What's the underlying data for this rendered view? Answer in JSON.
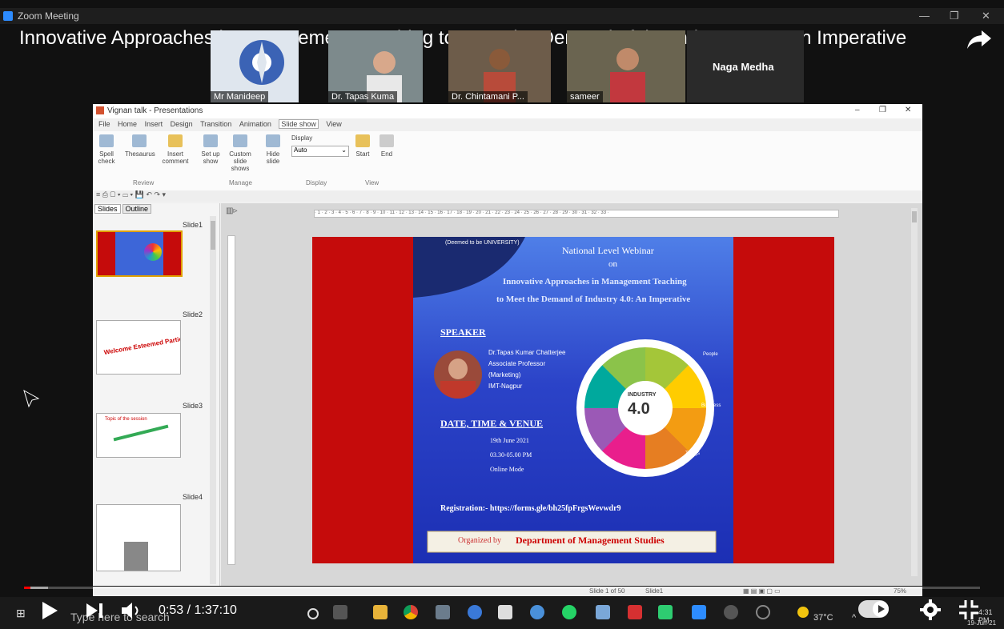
{
  "zoom": {
    "window_title": "Zoom Meeting"
  },
  "video": {
    "title": "Innovative Approaches in Management Teaching to Meet the Demand of the Industry 4.0 - An Imperative"
  },
  "participants": [
    {
      "name": "Mr Manideep"
    },
    {
      "name": "Dr. Tapas Kuma"
    },
    {
      "name": "Dr. Chintamani P..."
    },
    {
      "name": "sameer"
    },
    {
      "name": "Naga Medha"
    }
  ],
  "ppt": {
    "window_title": "Vignan talk - Presentations",
    "menu": [
      "File",
      "Home",
      "Insert",
      "Design",
      "Transition",
      "Animation",
      "Slide show",
      "View"
    ],
    "ribbon": {
      "spell_check": "Spell check",
      "thesaurus": "Thesaurus",
      "insert_comment": "Insert comment",
      "set_up_show": "Set up show",
      "custom_slide_shows": "Custom slide shows",
      "hide_slide": "Hide slide",
      "display_label": "Display",
      "display_value": "Auto",
      "start": "Start",
      "end": "End",
      "groups": [
        "Review",
        "Manage",
        "Display",
        "View"
      ]
    },
    "tabs": [
      "Slides",
      "Outline"
    ],
    "slide_labels": [
      "Slide1",
      "Slide2",
      "Slide3",
      "Slide4"
    ],
    "slide2_text": "Welcome Esteemed Participants !",
    "slide3_text": "Topic of the session",
    "status": {
      "slide_count": "Slide 1 of 50",
      "slide_name": "Slide1",
      "zoom": "75%"
    }
  },
  "slide": {
    "university": "(Deemed to be UNIVERSITY)",
    "heading1": "National Level Webinar",
    "heading2": "on",
    "heading3": "Innovative Approaches in Management Teaching",
    "heading4": "to Meet the Demand of Industry 4.0: An Imperative",
    "speaker_label": "SPEAKER",
    "speaker_name": "Dr.Tapas Kumar Chatterjee",
    "speaker_role": "Associate Professor",
    "speaker_dept": "(Marketing)",
    "speaker_org": "IMT-Nagpur",
    "dtv_label": "DATE, TIME & VENUE",
    "date": "19th June 2021",
    "time": "03.30-05.00 PM",
    "mode": "Online Mode",
    "registration": "Registration:-  https://forms.gle/bh25fpFrgsWevwdr9",
    "organized_pre": "Organized by",
    "organized_dept": "Department of Management Studies",
    "wheel_center": "INDUSTRY",
    "wheel_value": "4.0",
    "wheel_labels": [
      "People",
      "Business",
      "Things"
    ]
  },
  "player": {
    "time": "0:53 / 1:37:10",
    "played_fraction": 0.0063
  },
  "taskbar": {
    "search_placeholder": "Type here to search",
    "temperature": "37°C",
    "clock": "4:31 PM",
    "date": "19-Jun-21"
  }
}
